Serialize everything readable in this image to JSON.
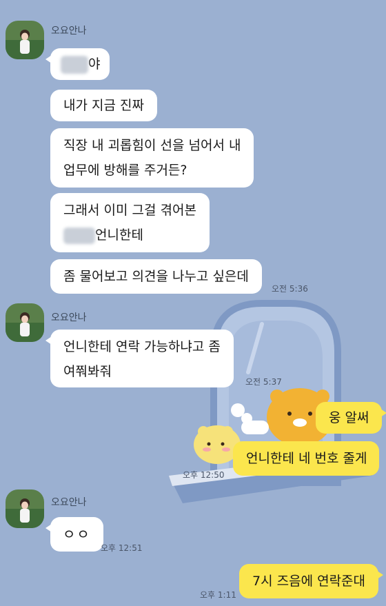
{
  "chat": {
    "sender_name": "오요안나",
    "messages": [
      {
        "text": "야"
      },
      {
        "text": "내가 지금 진짜"
      },
      {
        "lines": [
          "직장 내 괴롭힘이 선을 넘어서 내",
          "업무에 방해를 주거든?"
        ]
      },
      {
        "lines": [
          "그래서 이미 그걸 겪어본",
          "언니한테"
        ]
      },
      {
        "text": "좀 물어보고 의견을 나누고 싶은데",
        "time": "오전 5:36"
      },
      {
        "lines": [
          "언니한테 연락 가능하냐고 좀",
          "여쭤봐줘"
        ],
        "time": "오전 5:37"
      },
      {
        "text": "웅 알써"
      },
      {
        "text": "언니한테 네 번호 줄게",
        "time": "오후 12:50"
      },
      {
        "text": "ㅇㅇ",
        "time": "오후 12:51"
      },
      {
        "text": "7시 즈음에 연락준대",
        "time": "오후 1:11"
      }
    ]
  },
  "colors": {
    "background": "#9bb0d1",
    "bubble_other": "#ffffff",
    "bubble_me": "#fbe64d"
  },
  "icons": {
    "avatar": "profile-photo-avatar-icon",
    "background_art": "kakao-ryan-character-illustration"
  }
}
